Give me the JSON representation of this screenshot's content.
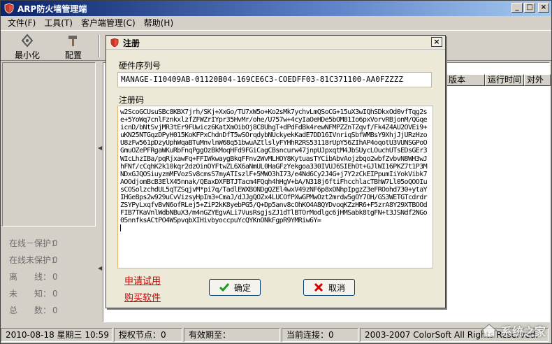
{
  "window": {
    "title": "ARP防火墙管理端",
    "minimize_glyph": "_",
    "maximize_glyph": "□",
    "close_glyph": "×"
  },
  "menu": [
    "文件(F)",
    "工具(T)",
    "客户端管理(C)",
    "帮助(H)"
  ],
  "toolbar": [
    {
      "label": "最小化",
      "icon": "minimize-icon"
    },
    {
      "label": "配置",
      "icon": "hammer-icon"
    }
  ],
  "left_stats": [
    {
      "label": "在线－保护：",
      "value": "0"
    },
    {
      "label": "在线未保护：",
      "value": "0"
    },
    {
      "label": "离　　线：",
      "value": "0"
    },
    {
      "label": "未　　知：",
      "value": "0"
    },
    {
      "label": "总　　数：",
      "value": "0"
    }
  ],
  "list_columns": [
    "版本",
    "运行时间",
    "对外"
  ],
  "statusbar": {
    "datetime": "2010-08-18 星期三 10:59",
    "licensed_nodes": "授权节点：0",
    "valid_until": "有效期至：",
    "current_connections": "当前连接：0",
    "copyright": "2003-2007 ColorSoft All Rights Reserved."
  },
  "watermark": {
    "text": "系统之家"
  },
  "dialog": {
    "title": "注册",
    "close_glyph": "×",
    "hardware_label": "硬件序列号",
    "hardware_serial": "MANAGE-I10409AB-01120B04-169CE6C3-COEDFF03-81C371100-AA0FZZZZ",
    "regcode_label": "注册码",
    "regcode": "w2ScoGCUsuSBc8KBX7jrh/SKj+XxGo/TU7xW5o+Ko2sMk7ychvLmQSoCG+15uX3wIQhSDkxOd0vfTqg2se+5YoWq7cnlFznkxlzfZFWZrIYpr35HvMr/ohe/U757w+4cyIaOeHDe5bOM81Io6pxVorvRBjonM/QGqeicnD/bNtSvjMR3tEr9FUwicz6KatXmOibOj8C8UhgT+dPdFdBk4rewNFMPZZnTZqvf/Fk4Z4AU2OVEi9+uKN25NTGqzDPyH015KoKFPxChdnDfT5wSOrqdybNUckyekKadE7DD16IVnriqSbfWMBsY9XhjJjURzHzoU8zFw561pDzyUphWqaBTuMnvlnW68q51bwuAZtlslyFYHhR2RS53118rUpY56ZIhAP4oqotU3VUNSGPoOGmuOZePFRgaWKuRbFnqPggOzBkMoqHFd9FGiCagCBsncurw47jnpUJpxqtM4JbSUycLOuchUTsEDsGEr3WIcLhzIBa/pqRjxawFq+FFIWkwaygBkqFFnv2WvMLHOY8KytuasTYCibAbvAojzbqo2wbfZvbvN8WH3wJhFNf/cCqhK2k10kqr2dzOinOYFtwZL6X6aNmUL0HaGFzYekgoa330IVUJ6SIEhOt+GJlWI16PKZ7t1P3MNDxGJQOSiuyzmMFVozSv8cmsS7myATIszlF+5MWO3hI73/e4Nd6Cy2J4G+j7Y2zCkEIPpumIiYokVibk7AOOdjomBcB3ElX45nnak/QEaxDXFBTJTacm4FQqh4hHgV+bA/N318j6ftiFhcchlacTBhW7Ll05oQOOIusCOSolzchdUL5qTZSqjvM*pi7q/TadlEWXBONDgQZEl4wxV49zNF6p8xONhpIpgzZ3eFROohd730+ytaYIHGe8ps2w929uCvVizsyHpIm3+CmaJ/dJJgQOZx4LUCOfPXwGPMwOzt2mrdw5gOY7OH/GS3WETGTcdrdrZSYPyLxqfvBvN6ofRLej5+ZiP2kK8yebPG5/Q+Dp5anv8cOhKO4A8QYDvoqKZzHR6+F5zrA8Y29XTBOOdFIB7TKaVnlWdbNBuX3/m4nGZYEgvALi7VusRsgjsZJ1dTlBTOrModlgc6jHMSabk8tgFN+t3JSNdf2NGo05nnfksACtPO4WSpvqbXIHivbyoccpuYcQYKnONkFgpR9YMRiw6Y=",
    "apply_trial_link": "申请试用",
    "buy_link": "购买软件",
    "ok_label": "确定",
    "cancel_label": "取消"
  },
  "colors": {
    "link": "#d40000",
    "title_gradient_start": "#0a246a",
    "ok_check": "#1a9a1a",
    "cancel_x": "#d40000"
  }
}
